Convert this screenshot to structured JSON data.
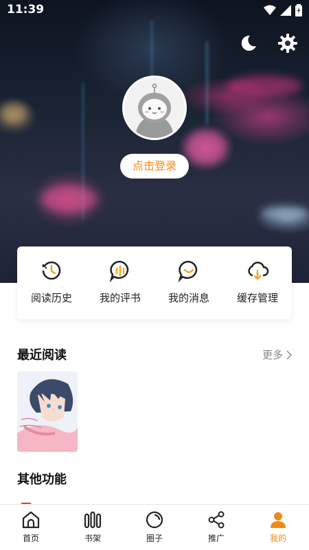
{
  "status_bar": {
    "time": "11:39"
  },
  "header": {
    "login_label": "点击登录",
    "icons": [
      "moon-icon",
      "gear-icon"
    ]
  },
  "quick_actions": [
    {
      "label": "阅读历史",
      "icon": "history-icon"
    },
    {
      "label": "我的评书",
      "icon": "comment-icon"
    },
    {
      "label": "我的消息",
      "icon": "message-icon"
    },
    {
      "label": "缓存管理",
      "icon": "cloud-download-icon"
    }
  ],
  "recent_reading": {
    "title": "最近阅读",
    "more_label": "更多"
  },
  "other_features": {
    "title": "其他功能"
  },
  "bottom_nav": {
    "tabs": [
      {
        "label": "首页",
        "icon": "home-icon"
      },
      {
        "label": "书架",
        "icon": "bookshelf-icon"
      },
      {
        "label": "圈子",
        "icon": "circle-icon"
      },
      {
        "label": "推广",
        "icon": "share-icon"
      },
      {
        "label": "我的",
        "icon": "profile-icon"
      }
    ],
    "active_index": 4
  },
  "colors": {
    "accent": "#f08a16",
    "card_icon": "#f5a623"
  }
}
